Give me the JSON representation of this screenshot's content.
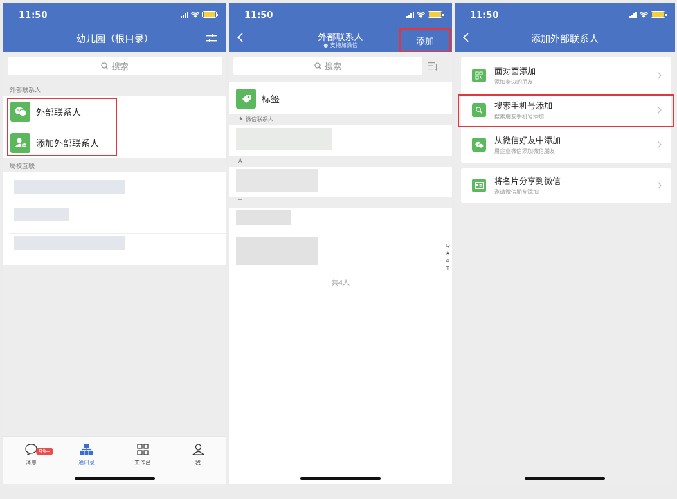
{
  "status": {
    "time": "11:50"
  },
  "screen1": {
    "title": "幼儿园（根目录）",
    "search_placeholder": "搜索",
    "section_external": "外部联系人",
    "row_external": "外部联系人",
    "row_add_external": "添加外部联系人",
    "section_school": "局校互联",
    "tabs": {
      "messages": "消息",
      "messages_badge": "99+",
      "contacts": "通讯录",
      "workbench": "工作台",
      "me": "我"
    }
  },
  "screen2": {
    "title": "外部联系人",
    "subtitle": "支持加微信",
    "add_button": "添加",
    "search_placeholder": "搜索",
    "tags_row": "标签",
    "section_wechat": "微信联系人",
    "letter_a": "A",
    "letter_t": "T",
    "index": [
      "Q",
      "★",
      "A",
      "T"
    ],
    "total": "共4人"
  },
  "screen3": {
    "title": "添加外部联系人",
    "options": [
      {
        "title": "面对面添加",
        "subtitle": "添加身边的朋友",
        "icon": "qr-code-icon"
      },
      {
        "title": "搜索手机号添加",
        "subtitle": "搜索朋友手机号添加",
        "icon": "search-icon"
      },
      {
        "title": "从微信好友中添加",
        "subtitle": "用企业微信添加微信朋友",
        "icon": "wechat-icon"
      },
      {
        "title": "将名片分享到微信",
        "subtitle": "邀请微信朋友添加",
        "icon": "business-card-icon"
      }
    ]
  },
  "colors": {
    "header_blue": "#4a73c4",
    "accent_green": "#5cb85c",
    "highlight_red": "#e0383e",
    "active_tab": "#3a6fcf"
  }
}
